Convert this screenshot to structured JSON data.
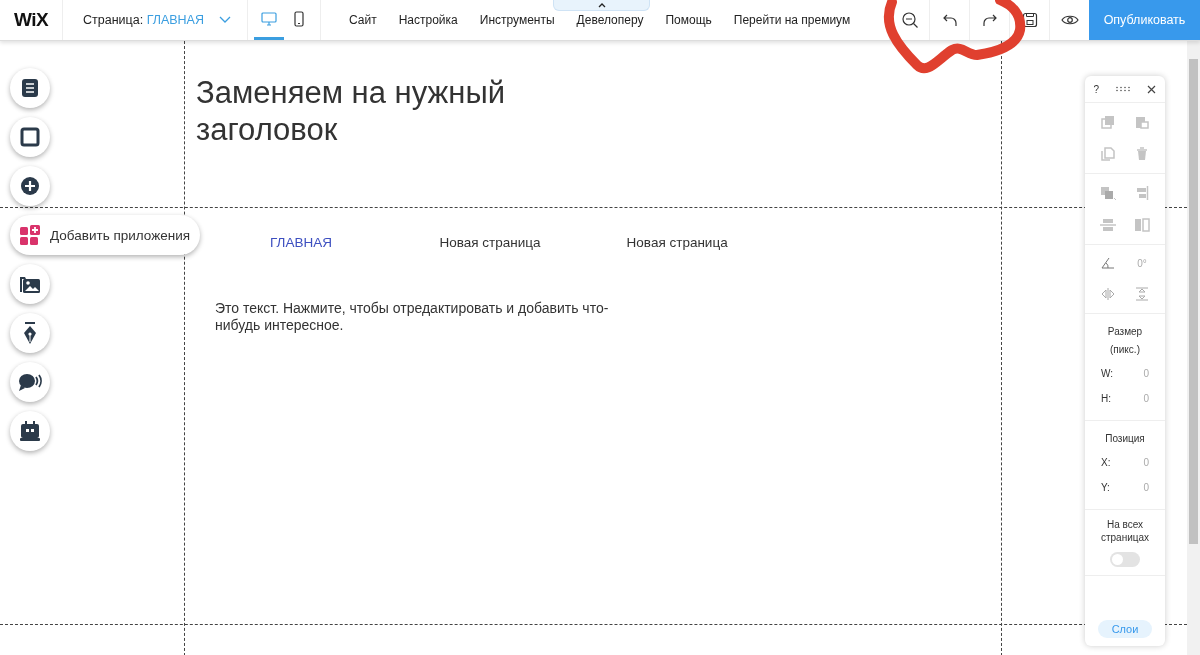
{
  "top_bar": {
    "logo": "WiX",
    "page_label": "Страница:",
    "page_name": "ГЛАВНАЯ",
    "devices": [
      {
        "kind": "desktop",
        "selected": true
      },
      {
        "kind": "mobile",
        "selected": false
      }
    ],
    "menu": [
      "Сайт",
      "Настройка",
      "Инструменты",
      "Девелоперу",
      "Помощь",
      "Перейти на премиум"
    ],
    "publish": "Опубликовать"
  },
  "left_toolbar": {
    "apps_label": "Добавить приложения"
  },
  "canvas": {
    "heading": "Заменяем на нужный заголовок",
    "nav": [
      {
        "label": "ГЛАВНАЯ",
        "selected": true
      },
      {
        "label": "Новая страница",
        "selected": false
      },
      {
        "label": "Новая страница",
        "selected": false
      }
    ],
    "paragraph": "Это текст. Нажмите, чтобы отредактировать и добавить что-нибудь интересное."
  },
  "inspector": {
    "help": "?",
    "rotation": "0°",
    "size_title": "Размер",
    "size_unit": "(пикс.)",
    "size_fields": [
      {
        "label": "W:",
        "value": "0"
      },
      {
        "label": "H:",
        "value": "0"
      }
    ],
    "position_title": "Позиция",
    "position_fields": [
      {
        "label": "X:",
        "value": "0"
      },
      {
        "label": "Y:",
        "value": "0"
      }
    ],
    "all_pages_label": "На всех страницах",
    "all_pages_on": false,
    "layers": "Слои"
  }
}
